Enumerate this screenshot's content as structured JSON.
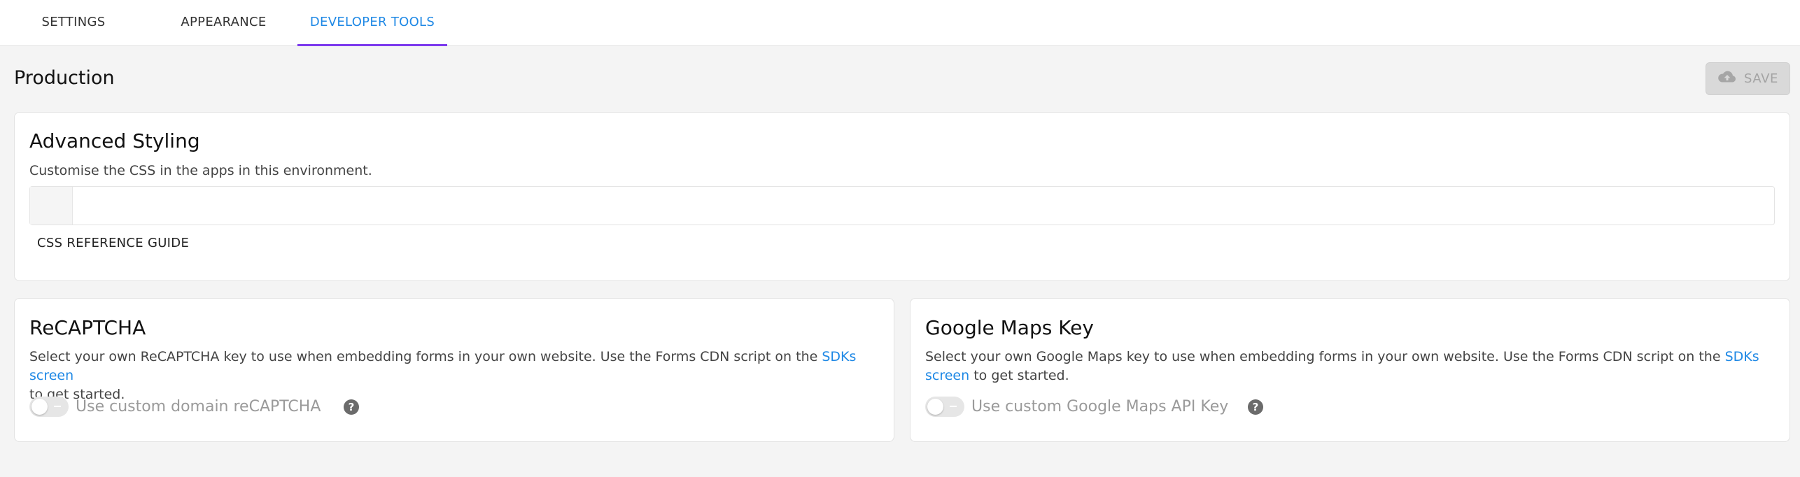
{
  "tabs": [
    {
      "label": "SETTINGS",
      "active": false
    },
    {
      "label": "APPEARANCE",
      "active": false
    },
    {
      "label": "DEVELOPER TOOLS",
      "active": true
    }
  ],
  "page": {
    "title": "Production",
    "save_label": "SAVE",
    "save_icon": "cloud-upload-icon"
  },
  "advanced_styling": {
    "title": "Advanced Styling",
    "description": "Customise the CSS in the apps in this environment.",
    "css_value": "",
    "guide_label": "CSS REFERENCE GUIDE"
  },
  "recaptcha": {
    "title": "ReCAPTCHA",
    "desc_line1_before": "Select your own ReCAPTCHA key to use when embedding forms in your own website. Use the Forms CDN script on the ",
    "desc_link": "SDKs screen",
    "desc_line2": "to get started.",
    "toggle_label": "Use custom domain reCAPTCHA",
    "toggle_on": false,
    "help_icon": "help-icon"
  },
  "google_maps": {
    "title": "Google Maps Key",
    "desc_line1_before": "Select your own Google Maps key to use when embedding forms in your own website. Use the Forms CDN script on the ",
    "desc_link_part1": "SDKs",
    "desc_link_part2": "screen",
    "desc_after": " to get started.",
    "toggle_label": "Use custom Google Maps API Key",
    "toggle_on": false,
    "help_icon": "help-icon"
  },
  "colors": {
    "accent": "#1e88e5",
    "active_underline": "#7c3aed",
    "save_disabled": "#d9d9d9"
  }
}
